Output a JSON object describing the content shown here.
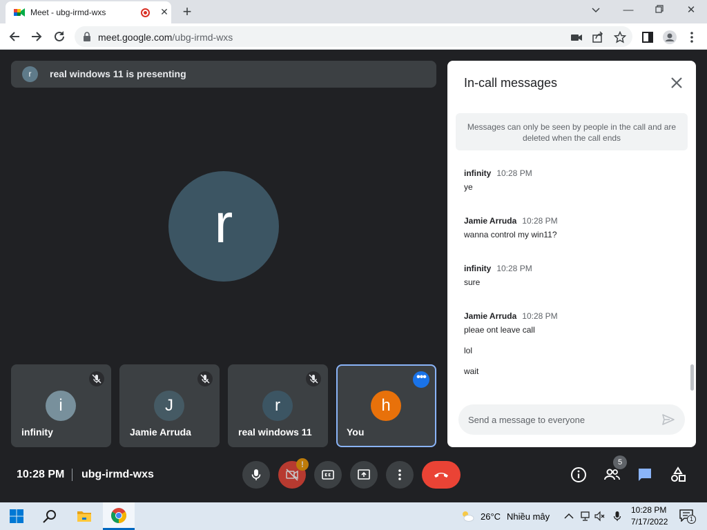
{
  "browser": {
    "tab_title": "Meet - ubg-irmd-wxs",
    "url_domain": "meet.google.com",
    "url_path": "/ubg-irmd-wxs"
  },
  "meet": {
    "presenting_avatar_letter": "r",
    "presenting_text": "real windows 11 is presenting",
    "main_avatar_letter": "r",
    "tiles": [
      {
        "letter": "i",
        "name": "infinity",
        "color": "#78909c"
      },
      {
        "letter": "J",
        "name": "Jamie Arruda",
        "color": "#455a64"
      },
      {
        "letter": "r",
        "name": "real windows 11",
        "color": "#3c5563"
      },
      {
        "letter": "h",
        "name": "You",
        "color": "#e8710a"
      }
    ],
    "time": "10:28 PM",
    "code": "ubg-irmd-wxs",
    "camera_warning": "!",
    "people_count": "5"
  },
  "chat": {
    "title": "In-call messages",
    "notice": "Messages can only be seen by people in the call and are deleted when the call ends",
    "messages": [
      {
        "sender": "infinity",
        "time": "10:28 PM",
        "lines": [
          "ye"
        ]
      },
      {
        "sender": "Jamie Arruda",
        "time": "10:28 PM",
        "lines": [
          "wanna control my win11?"
        ]
      },
      {
        "sender": "infinity",
        "time": "10:28 PM",
        "lines": [
          "sure"
        ]
      },
      {
        "sender": "Jamie Arruda",
        "time": "10:28 PM",
        "lines": [
          "pleae ont leave call",
          "lol",
          "wait"
        ]
      }
    ],
    "input_placeholder": "Send a message to everyone"
  },
  "taskbar": {
    "weather_temp": "26°C",
    "weather_text": "Nhiều mây",
    "clock_time": "10:28 PM",
    "clock_date": "7/17/2022",
    "notification_count": "1"
  },
  "colors": {
    "accent": "#1a73e8",
    "hangup": "#ea4335",
    "meet_bg": "#202124"
  }
}
